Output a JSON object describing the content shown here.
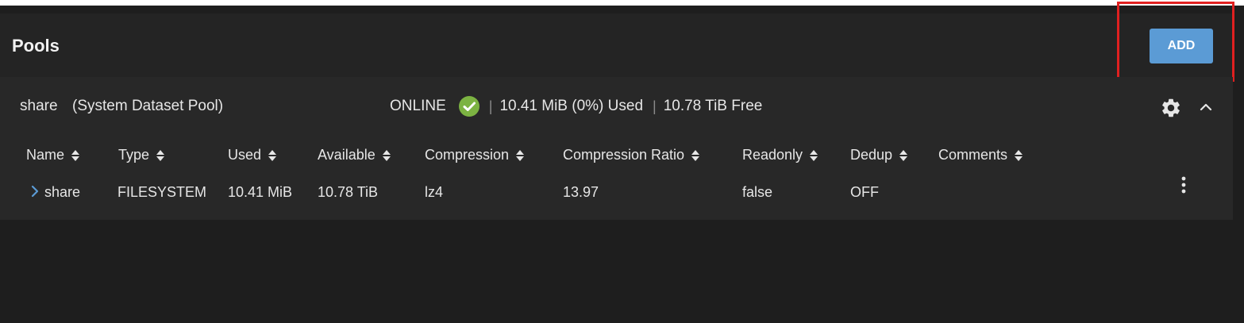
{
  "header": {
    "title": "Pools",
    "add_label": "ADD"
  },
  "pool": {
    "name": "share",
    "description": "(System Dataset Pool)",
    "status": "ONLINE",
    "used": "10.41 MiB (0%) Used",
    "free": "10.78 TiB Free",
    "separator": "|"
  },
  "table": {
    "columns": [
      "Name",
      "Type",
      "Used",
      "Available",
      "Compression",
      "Compression Ratio",
      "Readonly",
      "Dedup",
      "Comments"
    ],
    "rows": [
      [
        "share",
        "FILESYSTEM",
        "10.41 MiB",
        "10.78 TiB",
        "lz4",
        "13.97",
        "false",
        "OFF",
        ""
      ]
    ]
  },
  "icons": {
    "status": "check-circle-icon",
    "settings": "gear-icon",
    "collapse": "chevron-up-icon",
    "expand": "chevron-right-icon",
    "sort": "sort-icon",
    "row_actions": "more-vert-icon"
  },
  "colors": {
    "accent": "#5b9bd5",
    "success": "#7cb342",
    "highlight": "#e02020"
  }
}
